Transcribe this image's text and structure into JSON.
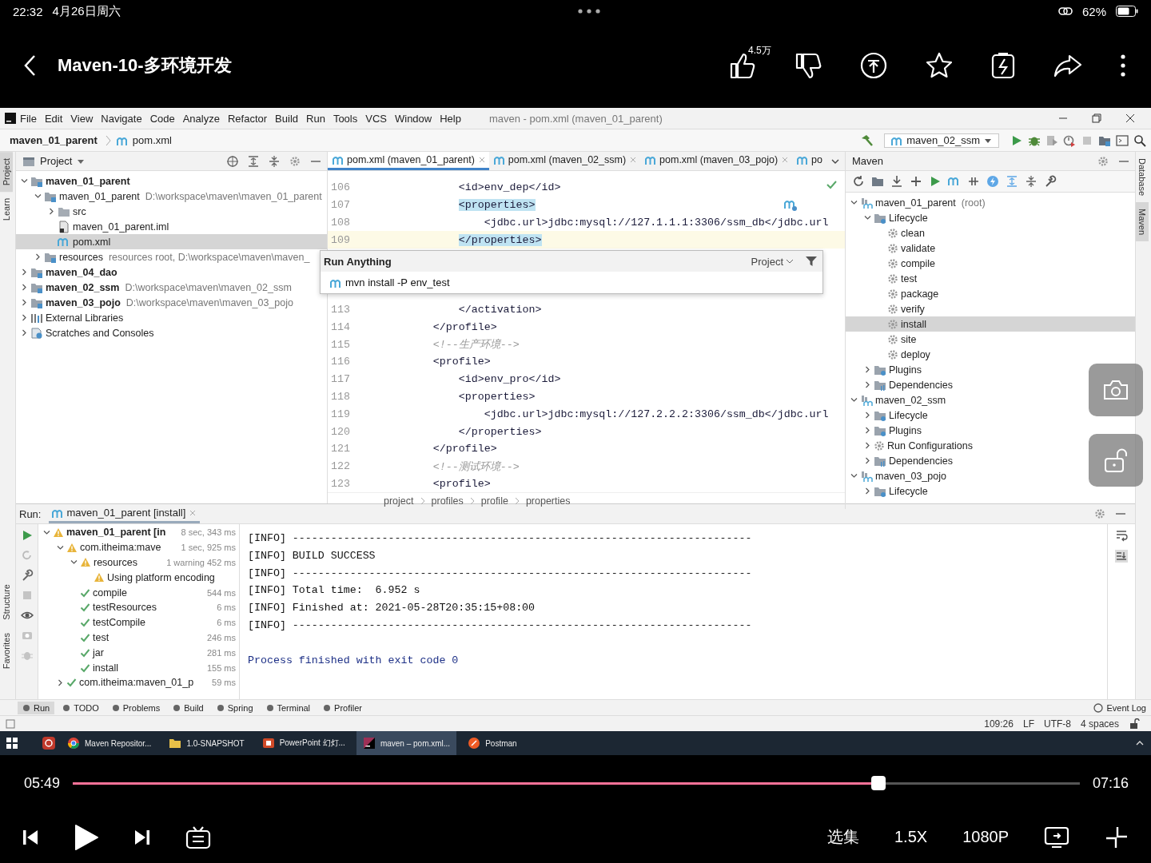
{
  "device_status": {
    "time": "22:32",
    "date": "4月26日周六",
    "battery": "62%"
  },
  "player_header": {
    "title": "Maven-10-多环境开发",
    "like_count": "4.5万"
  },
  "ide": {
    "menu": [
      "File",
      "Edit",
      "View",
      "Navigate",
      "Code",
      "Analyze",
      "Refactor",
      "Build",
      "Run",
      "Tools",
      "VCS",
      "Window",
      "Help"
    ],
    "window_title": "maven - pom.xml (maven_01_parent)",
    "breadcrumb": [
      "maven_01_parent",
      "pom.xml"
    ],
    "run_config": "maven_02_ssm",
    "left_tool_tabs": [
      {
        "label": "Project",
        "selected": true
      },
      {
        "label": "Learn",
        "selected": false
      }
    ],
    "left_tool_tabs_bottom": [
      {
        "label": "Structure",
        "selected": false
      },
      {
        "label": "Favorites",
        "selected": false
      }
    ],
    "right_tool_tabs": [
      {
        "label": "Database",
        "selected": false
      },
      {
        "label": "Maven",
        "selected": true
      }
    ],
    "project": {
      "title": "Project",
      "tree": [
        {
          "label": "maven_01_parent",
          "kind": "module",
          "bold": true,
          "expanded": true,
          "selected": false,
          "children": [
            {
              "label": "maven_01_parent",
              "detail": "D:\\workspace\\maven\\maven_01_parent",
              "kind": "module",
              "bold": false,
              "expanded": true,
              "selected": false,
              "children": [
                {
                  "label": "src",
                  "kind": "folder",
                  "bold": false,
                  "expanded": false,
                  "selected": false
                },
                {
                  "label": "maven_01_parent.iml",
                  "kind": "iml",
                  "bold": false,
                  "selected": false
                },
                {
                  "label": "pom.xml",
                  "kind": "pom",
                  "bold": false,
                  "selected": true
                }
              ]
            },
            {
              "label": "resources",
              "detail": "resources root,  D:\\workspace\\maven\\maven_",
              "kind": "module",
              "bold": false,
              "expanded": false,
              "selected": false
            }
          ]
        },
        {
          "label": "maven_04_dao",
          "kind": "module",
          "bold": true,
          "expanded": false,
          "selected": false
        },
        {
          "label": "maven_02_ssm",
          "detail": "D:\\workspace\\maven\\maven_02_ssm",
          "kind": "module",
          "bold": true,
          "expanded": false,
          "selected": false
        },
        {
          "label": "maven_03_pojo",
          "detail": "D:\\workspace\\maven\\maven_03_pojo",
          "kind": "module",
          "bold": true,
          "expanded": false,
          "selected": false
        },
        {
          "label": "External Libraries",
          "kind": "libraries",
          "bold": false,
          "expanded": false,
          "selected": false
        },
        {
          "label": "Scratches and Consoles",
          "kind": "scratches",
          "bold": false,
          "expanded": false,
          "selected": false
        }
      ]
    },
    "editor": {
      "tabs": [
        {
          "label": "pom.xml (maven_01_parent)",
          "selected": true
        },
        {
          "label": "pom.xml (maven_02_ssm)",
          "selected": false
        },
        {
          "label": "pom.xml (maven_03_pojo)",
          "selected": false
        },
        {
          "label": "po",
          "selected": false
        }
      ],
      "lines": [
        {
          "number": "106",
          "text": "            <id>env_dep</id>",
          "kind": "code",
          "matched": false,
          "current": false
        },
        {
          "number": "107",
          "text": "            <properties>",
          "kind": "code",
          "matched": true,
          "current": false
        },
        {
          "number": "108",
          "text": "                <jdbc.url>jdbc:mysql://127.1.1.1:3306/ssm_db</jdbc.url",
          "kind": "code",
          "matched": false,
          "current": false
        },
        {
          "number": "109",
          "text": "            </properties>",
          "kind": "code",
          "matched": true,
          "current": true
        },
        {
          "kind": "hidden"
        },
        {
          "kind": "hidden"
        },
        {
          "kind": "hidden"
        },
        {
          "number": "113",
          "text": "            </activation>",
          "kind": "code",
          "matched": false,
          "current": false
        },
        {
          "number": "114",
          "text": "        </profile>",
          "kind": "code",
          "matched": false,
          "current": false
        },
        {
          "number": "115",
          "text": "        <!--生产环境-->",
          "kind": "comment",
          "matched": false,
          "current": false
        },
        {
          "number": "116",
          "text": "        <profile>",
          "kind": "code",
          "matched": false,
          "current": false
        },
        {
          "number": "117",
          "text": "            <id>env_pro</id>",
          "kind": "code",
          "matched": false,
          "current": false
        },
        {
          "number": "118",
          "text": "            <properties>",
          "kind": "code",
          "matched": false,
          "current": false
        },
        {
          "number": "119",
          "text": "                <jdbc.url>jdbc:mysql://127.2.2.2:3306/ssm_db</jdbc.url",
          "kind": "code",
          "matched": false,
          "current": false
        },
        {
          "number": "120",
          "text": "            </properties>",
          "kind": "code",
          "matched": false,
          "current": false
        },
        {
          "number": "121",
          "text": "        </profile>",
          "kind": "code",
          "matched": false,
          "current": false
        },
        {
          "number": "122",
          "text": "        <!--测试环境-->",
          "kind": "comment",
          "matched": false,
          "current": false
        },
        {
          "number": "123",
          "text": "        <profile>",
          "kind": "code",
          "matched": false,
          "current": false
        }
      ],
      "breadcrumbs": [
        "project",
        "profiles",
        "profile",
        "properties"
      ]
    },
    "run_anything": {
      "title": "Run Anything",
      "scope": "Project",
      "value": "mvn install -P env_test"
    },
    "maven": {
      "title": "Maven",
      "tree": [
        {
          "label": "maven_01_parent",
          "detail": "(root)",
          "kind": "project",
          "expanded": true,
          "selected": false,
          "children": [
            {
              "label": "Lifecycle",
              "kind": "lifecycle",
              "expanded": true,
              "selected": false,
              "children": [
                {
                  "label": "clean",
                  "kind": "goal",
                  "selected": false
                },
                {
                  "label": "validate",
                  "kind": "goal",
                  "selected": false
                },
                {
                  "label": "compile",
                  "kind": "goal",
                  "selected": false
                },
                {
                  "label": "test",
                  "kind": "goal",
                  "selected": false
                },
                {
                  "label": "package",
                  "kind": "goal",
                  "selected": false
                },
                {
                  "label": "verify",
                  "kind": "goal",
                  "selected": false
                },
                {
                  "label": "install",
                  "kind": "goal",
                  "selected": true
                },
                {
                  "label": "site",
                  "kind": "goal",
                  "selected": false
                },
                {
                  "label": "deploy",
                  "kind": "goal",
                  "selected": false
                }
              ]
            },
            {
              "label": "Plugins",
              "kind": "lifecycle",
              "expanded": false,
              "selected": false
            },
            {
              "label": "Dependencies",
              "kind": "dependencies",
              "expanded": false,
              "selected": false
            }
          ]
        },
        {
          "label": "maven_02_ssm",
          "kind": "project",
          "expanded": true,
          "selected": false,
          "children": [
            {
              "label": "Lifecycle",
              "kind": "lifecycle",
              "expanded": false,
              "selected": false
            },
            {
              "label": "Plugins",
              "kind": "lifecycle",
              "expanded": false,
              "selected": false
            },
            {
              "label": "Run Configurations",
              "kind": "goal",
              "expanded": false,
              "selected": false
            },
            {
              "label": "Dependencies",
              "kind": "dependencies",
              "expanded": false,
              "selected": false
            }
          ]
        },
        {
          "label": "maven_03_pojo",
          "kind": "project",
          "expanded": true,
          "selected": false,
          "children": [
            {
              "label": "Lifecycle",
              "kind": "lifecycle",
              "expanded": false,
              "selected": false
            }
          ]
        }
      ]
    },
    "run": {
      "label": "Run:",
      "tab": "maven_01_parent [install]",
      "tree": [
        {
          "label": "maven_01_parent [in",
          "time": "8 sec, 343 ms",
          "kind": "warning",
          "bold": true,
          "expanded": true,
          "children": [
            {
              "label": "com.itheima:mave",
              "time": "1 sec, 925 ms",
              "kind": "warning",
              "bold": false,
              "expanded": true,
              "children": [
                {
                  "label": "resources",
                  "time": "1 warning 452 ms",
                  "kind": "warning",
                  "bold": false,
                  "expanded": true,
                  "children": [
                    {
                      "label": "Using platform encoding",
                      "kind": "warning",
                      "bold": false
                    }
                  ]
                },
                {
                  "label": "compile",
                  "time": "544 ms",
                  "kind": "ok",
                  "bold": false
                },
                {
                  "label": "testResources",
                  "time": "6 ms",
                  "kind": "ok",
                  "bold": false
                },
                {
                  "label": "testCompile",
                  "time": "6 ms",
                  "kind": "ok",
                  "bold": false
                },
                {
                  "label": "test",
                  "time": "246 ms",
                  "kind": "ok",
                  "bold": false
                },
                {
                  "label": "jar",
                  "time": "281 ms",
                  "kind": "ok",
                  "bold": false
                },
                {
                  "label": "install",
                  "time": "155 ms",
                  "kind": "ok",
                  "bold": false
                }
              ]
            },
            {
              "label": "com.itheima:maven_01_p",
              "time": "59 ms",
              "kind": "ok",
              "bold": false,
              "expanded": false
            }
          ]
        }
      ],
      "console": [
        {
          "text": "[INFO] ------------------------------------------------------------------------",
          "kind": "info"
        },
        {
          "text": "[INFO] BUILD SUCCESS",
          "kind": "info"
        },
        {
          "text": "[INFO] ------------------------------------------------------------------------",
          "kind": "info"
        },
        {
          "text": "[INFO] Total time:  6.952 s",
          "kind": "info"
        },
        {
          "text": "[INFO] Finished at: 2021-05-28T20:35:15+08:00",
          "kind": "info"
        },
        {
          "text": "[INFO] ------------------------------------------------------------------------",
          "kind": "info"
        },
        {
          "kind": "blank"
        },
        {
          "text": "Process finished with exit code 0",
          "kind": "process"
        }
      ]
    },
    "tool_tabs": [
      {
        "label": "Run",
        "selected": true
      },
      {
        "label": "TODO",
        "selected": false
      },
      {
        "label": "Problems",
        "selected": false
      },
      {
        "label": "Build",
        "selected": false
      },
      {
        "label": "Spring",
        "selected": false
      },
      {
        "label": "Terminal",
        "selected": false
      },
      {
        "label": "Profiler",
        "selected": false
      }
    ],
    "event_log": "Event Log",
    "status": [
      "109:26",
      "LF",
      "UTF-8",
      "4 spaces"
    ]
  },
  "taskbar": [
    {
      "label": "Maven Repositor...",
      "kind": "browser",
      "selected": false
    },
    {
      "label": "1.0-SNAPSHOT",
      "kind": "folder",
      "selected": false
    },
    {
      "label": "PowerPoint 幻灯...",
      "kind": "slides",
      "selected": false
    },
    {
      "label": "maven – pom.xml...",
      "kind": "ide",
      "selected": true
    },
    {
      "label": "Postman",
      "kind": "postman",
      "selected": false
    }
  ],
  "player": {
    "elapsed": "05:49",
    "level": 0.8,
    "duration": "07:16",
    "episodes": "选集",
    "speed": "1.5X",
    "quality": "1080P"
  }
}
